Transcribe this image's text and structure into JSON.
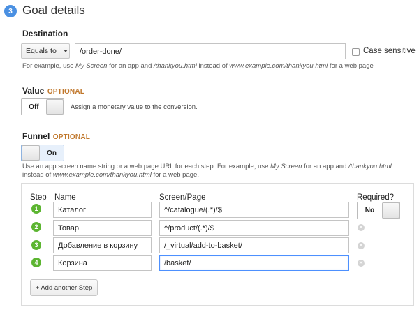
{
  "header": {
    "step_number": "3",
    "title": "Goal details"
  },
  "destination": {
    "label": "Destination",
    "match_type": "Equals to",
    "value": "/order-done/",
    "case_sensitive_label": "Case sensitive",
    "hint": {
      "p1": "For example, use ",
      "e1": "My Screen",
      "p2": " for an app and ",
      "e2": "/thankyou.html",
      "p3": " instead of ",
      "e3": "www.example.com/thankyou.html",
      "p4": " for a web page"
    }
  },
  "value_section": {
    "label": "Value",
    "optional": "OPTIONAL",
    "toggle_label": "Off",
    "description": "Assign a monetary value to the conversion."
  },
  "funnel": {
    "label": "Funnel",
    "optional": "OPTIONAL",
    "toggle_label": "On",
    "hint": {
      "p1": "Use an app screen name string or a web page URL for each step. For example, use ",
      "e1": "My Screen",
      "p2": " for an app and ",
      "e2": "/thankyou.html",
      "p3": "instead of ",
      "e3": "www.example.com/thankyou.html",
      "p4": " for a web page."
    },
    "columns": {
      "step": "Step",
      "name": "Name",
      "screen": "Screen/Page",
      "required": "Required?"
    },
    "required_toggle": "No",
    "steps": [
      {
        "num": "1",
        "name": "Каталог",
        "page": "^/catalogue/(.*)/$"
      },
      {
        "num": "2",
        "name": "Товар",
        "page": "^/product/(.*)/$"
      },
      {
        "num": "3",
        "name": "Добавление в корзину",
        "page": "/_virtual/add-to-basket/"
      },
      {
        "num": "4",
        "name": "Корзина",
        "page": "/basket/"
      }
    ],
    "add_step_label": "+ Add another Step"
  },
  "colors": {
    "accent": "#4a90e2",
    "step_green": "#5cb531",
    "optional_orange": "#c0772b"
  }
}
